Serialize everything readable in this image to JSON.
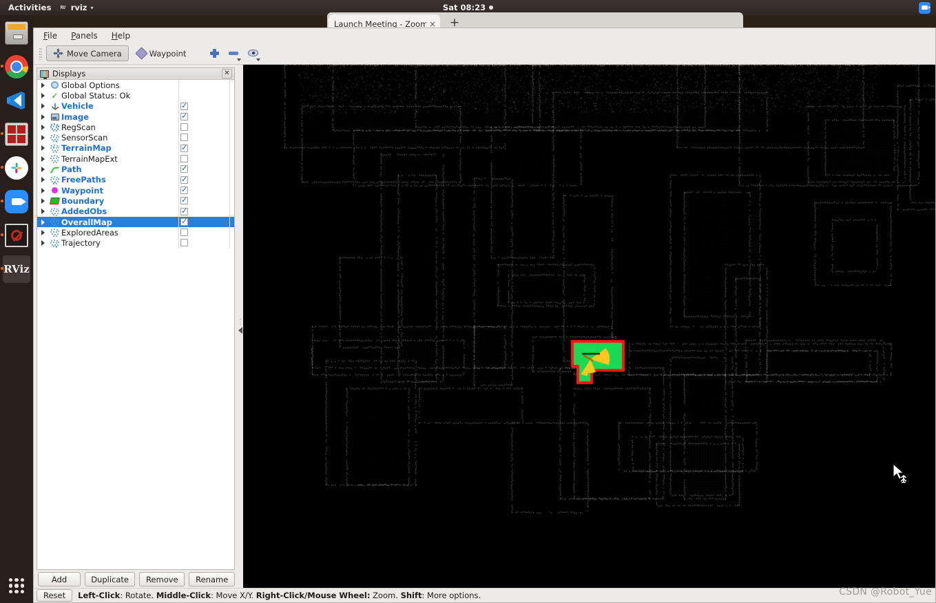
{
  "desktop": {
    "activities_label": "Activities",
    "app_name": "rviz",
    "app_icon": "rviz-app-icon",
    "clock": "Sat 08:23",
    "tray": [
      {
        "name": "zoom-tray-icon"
      }
    ],
    "dock": [
      {
        "name": "dock-item-files",
        "label": "Files",
        "running": false
      },
      {
        "name": "dock-item-chrome",
        "label": "Google Chrome",
        "running": true
      },
      {
        "name": "dock-item-vscode",
        "label": "Visual Studio Code",
        "running": false
      },
      {
        "name": "dock-item-terminator",
        "label": "Terminator",
        "running": true
      },
      {
        "name": "dock-item-slack",
        "label": "Slack",
        "running": true
      },
      {
        "name": "dock-item-zoom",
        "label": "Zoom",
        "running": true
      },
      {
        "name": "dock-item-blocked-terminal",
        "label": "Terminal",
        "running": true
      },
      {
        "name": "dock-item-rviz",
        "label": "RViz",
        "running": true,
        "active": true
      }
    ],
    "show_apps_label": "Show Applications"
  },
  "browser": {
    "tab_title": "Launch Meeting - Zoom",
    "close_label": "×",
    "newtab_label": "+"
  },
  "rviz": {
    "menu": [
      {
        "label": "File",
        "accel": "F"
      },
      {
        "label": "Panels",
        "accel": "P"
      },
      {
        "label": "Help",
        "accel": "H"
      }
    ],
    "toolbar": {
      "tools": [
        {
          "label": "Move Camera",
          "icon": "move-camera-icon",
          "active": true
        },
        {
          "label": "Waypoint",
          "icon": "waypoint-diamond-icon",
          "active": false
        }
      ],
      "buttons": [
        {
          "name": "add-tool-button",
          "icon": "plus-icon"
        },
        {
          "name": "remove-tool-button",
          "icon": "minus-icon"
        },
        {
          "name": "tool-properties-button",
          "icon": "eye-icon"
        }
      ]
    },
    "displays_panel": {
      "title": "Displays",
      "close_label": "✕",
      "items": [
        {
          "label": "Global Options",
          "icon": "gear-icon",
          "enabled": null,
          "highlight": false,
          "selected": false
        },
        {
          "label": "Global Status: Ok",
          "icon": "check-icon",
          "enabled": null,
          "highlight": false,
          "selected": false
        },
        {
          "label": "Vehicle",
          "icon": "axes-icon",
          "enabled": true,
          "highlight": true,
          "selected": false
        },
        {
          "label": "Image",
          "icon": "image-icon",
          "enabled": true,
          "highlight": true,
          "selected": false
        },
        {
          "label": "RegScan",
          "icon": "pointcloud-icon",
          "enabled": false,
          "highlight": false,
          "selected": false
        },
        {
          "label": "SensorScan",
          "icon": "pointcloud-icon",
          "enabled": false,
          "highlight": false,
          "selected": false
        },
        {
          "label": "TerrainMap",
          "icon": "pointcloud-icon",
          "enabled": true,
          "highlight": true,
          "selected": false
        },
        {
          "label": "TerrainMapExt",
          "icon": "pointcloud-icon",
          "enabled": false,
          "highlight": false,
          "selected": false
        },
        {
          "label": "Path",
          "icon": "path-icon",
          "enabled": true,
          "highlight": true,
          "selected": false
        },
        {
          "label": "FreePaths",
          "icon": "pointcloud-icon",
          "enabled": true,
          "highlight": true,
          "selected": false
        },
        {
          "label": "Waypoint",
          "icon": "waypoint-dot-icon",
          "enabled": true,
          "highlight": true,
          "selected": false
        },
        {
          "label": "Boundary",
          "icon": "polygon-icon",
          "enabled": true,
          "highlight": true,
          "selected": false
        },
        {
          "label": "AddedObs",
          "icon": "pointcloud-icon",
          "enabled": true,
          "highlight": true,
          "selected": false
        },
        {
          "label": "OverallMap",
          "icon": "pointcloud-icon",
          "enabled": true,
          "highlight": true,
          "selected": true
        },
        {
          "label": "ExploredAreas",
          "icon": "pointcloud-icon",
          "enabled": false,
          "highlight": false,
          "selected": false
        },
        {
          "label": "Trajectory",
          "icon": "pointcloud-icon",
          "enabled": false,
          "highlight": false,
          "selected": false
        }
      ],
      "buttons": [
        {
          "name": "add-display-button",
          "label": "Add"
        },
        {
          "name": "duplicate-display-button",
          "label": "Duplicate"
        },
        {
          "name": "remove-display-button",
          "label": "Remove"
        },
        {
          "name": "rename-display-button",
          "label": "Rename"
        }
      ]
    },
    "statusbar": {
      "reset_label": "Reset",
      "hints": [
        {
          "key": "Left-Click",
          "action": ": Rotate."
        },
        {
          "key": "Middle-Click",
          "action": ": Move X/Y."
        },
        {
          "key": "Right-Click/Mouse Wheel:",
          "action": " Zoom."
        },
        {
          "key": "Shift",
          "action": ": More options."
        }
      ]
    },
    "view": {
      "background_color": "#000000",
      "terrain_color": "#19d955",
      "boundary_color": "#ff1414",
      "freepaths_color": "#ffc81e",
      "pointcloud_color": "#4a4a4a",
      "cursor": "move-xy-cursor"
    }
  },
  "watermark": "CSDN @Robot_Yue"
}
